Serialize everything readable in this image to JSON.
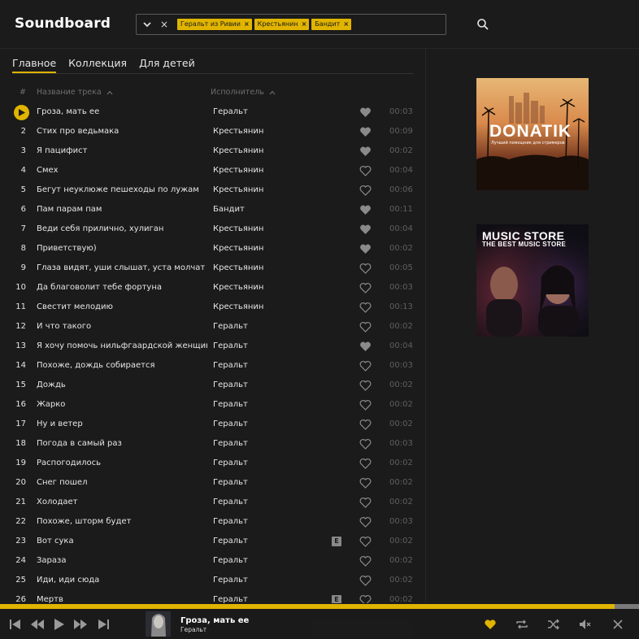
{
  "app": {
    "title": "Soundboard"
  },
  "search": {
    "chips": [
      "Геральт из Ривии",
      "Крестьянин",
      "Бандит"
    ],
    "clear_symbol": "×",
    "chip_remove_symbol": "×"
  },
  "tabs": [
    {
      "label": "Главное",
      "active": true
    },
    {
      "label": "Коллекция",
      "active": false
    },
    {
      "label": "Для детей",
      "active": false
    }
  ],
  "table": {
    "headers": {
      "num": "#",
      "title": "Название трека",
      "artist": "Исполнитель"
    },
    "rows": [
      {
        "num": "1",
        "title": "Гроза, мать ее",
        "artist": "Геральт",
        "liked": true,
        "explicit": false,
        "duration": "00:03",
        "playing": true
      },
      {
        "num": "2",
        "title": "Стих про ведьмака",
        "artist": "Крестьянин",
        "liked": true,
        "explicit": false,
        "duration": "00:09"
      },
      {
        "num": "3",
        "title": "Я пацифист",
        "artist": "Крестьянин",
        "liked": true,
        "explicit": false,
        "duration": "00:02"
      },
      {
        "num": "4",
        "title": "Смех",
        "artist": "Крестьянин",
        "liked": false,
        "explicit": false,
        "duration": "00:04"
      },
      {
        "num": "5",
        "title": "Бегут неуклюже пешеходы по лужам",
        "artist": "Крестьянин",
        "liked": false,
        "explicit": false,
        "duration": "00:06"
      },
      {
        "num": "6",
        "title": "Пам парам пам",
        "artist": "Бандит",
        "liked": true,
        "explicit": false,
        "duration": "00:11"
      },
      {
        "num": "7",
        "title": "Веди себя прилично, хулиган",
        "artist": "Крестьянин",
        "liked": true,
        "explicit": false,
        "duration": "00:04"
      },
      {
        "num": "8",
        "title": "Приветствую)",
        "artist": "Крестьянин",
        "liked": true,
        "explicit": false,
        "duration": "00:02"
      },
      {
        "num": "9",
        "title": "Глаза видят, уши слышат, уста молчат",
        "artist": "Крестьянин",
        "liked": false,
        "explicit": false,
        "duration": "00:05"
      },
      {
        "num": "10",
        "title": "Да благоволит тебе фортуна",
        "artist": "Крестьянин",
        "liked": false,
        "explicit": false,
        "duration": "00:03"
      },
      {
        "num": "11",
        "title": "Свестит мелодию",
        "artist": "Крестьянин",
        "liked": false,
        "explicit": false,
        "duration": "00:13"
      },
      {
        "num": "12",
        "title": "И что такого",
        "artist": "Геральт",
        "liked": false,
        "explicit": false,
        "duration": "00:02"
      },
      {
        "num": "13",
        "title": "Я хочу помочь нильфгаардской женщине",
        "artist": "Геральт",
        "liked": true,
        "explicit": false,
        "duration": "00:04"
      },
      {
        "num": "14",
        "title": "Похоже, дождь собирается",
        "artist": "Геральт",
        "liked": false,
        "explicit": false,
        "duration": "00:03"
      },
      {
        "num": "15",
        "title": "Дождь",
        "artist": "Геральт",
        "liked": false,
        "explicit": false,
        "duration": "00:02"
      },
      {
        "num": "16",
        "title": "Жарко",
        "artist": "Геральт",
        "liked": false,
        "explicit": false,
        "duration": "00:02"
      },
      {
        "num": "17",
        "title": "Ну и ветер",
        "artist": "Геральт",
        "liked": false,
        "explicit": false,
        "duration": "00:02"
      },
      {
        "num": "18",
        "title": "Погода в самый раз",
        "artist": "Геральт",
        "liked": false,
        "explicit": false,
        "duration": "00:03"
      },
      {
        "num": "19",
        "title": "Распогодилось",
        "artist": "Геральт",
        "liked": false,
        "explicit": false,
        "duration": "00:02"
      },
      {
        "num": "20",
        "title": "Снег пошел",
        "artist": "Геральт",
        "liked": false,
        "explicit": false,
        "duration": "00:02"
      },
      {
        "num": "21",
        "title": "Холодает",
        "artist": "Геральт",
        "liked": false,
        "explicit": false,
        "duration": "00:02"
      },
      {
        "num": "22",
        "title": "Похоже, шторм будет",
        "artist": "Геральт",
        "liked": false,
        "explicit": false,
        "duration": "00:03"
      },
      {
        "num": "23",
        "title": "Вот сука",
        "artist": "Геральт",
        "liked": false,
        "explicit": true,
        "duration": "00:02"
      },
      {
        "num": "24",
        "title": "Зараза",
        "artist": "Геральт",
        "liked": false,
        "explicit": false,
        "duration": "00:02"
      },
      {
        "num": "25",
        "title": "Иди, иди сюда",
        "artist": "Геральт",
        "liked": false,
        "explicit": false,
        "duration": "00:02"
      },
      {
        "num": "26",
        "title": "Мертв",
        "artist": "Геральт",
        "liked": false,
        "explicit": true,
        "duration": "00:02"
      }
    ],
    "explicit_label": "E"
  },
  "ads": [
    {
      "brand": "DONATIK",
      "tagline": "Лучший помощник для стримеров"
    },
    {
      "line1": "MUSIC STORE",
      "line2": "THE BEST MUSIC STORE"
    }
  ],
  "player": {
    "title": "Гроза, мать ее",
    "artist": "Геральт",
    "progress": 0.962,
    "liked": true
  },
  "colors": {
    "accent": "#e0b400",
    "background": "#1b1b1b",
    "muted": "#5f5f5f"
  },
  "icons": [
    "chevron-down-icon",
    "clear-icon",
    "search-icon",
    "sort-up-icon",
    "play-icon",
    "heart-icon",
    "explicit-badge",
    "skip-start-icon",
    "rewind-icon",
    "forward-icon",
    "skip-end-icon",
    "repeat-icon",
    "shuffle-icon",
    "volume-icon",
    "close-icon"
  ]
}
